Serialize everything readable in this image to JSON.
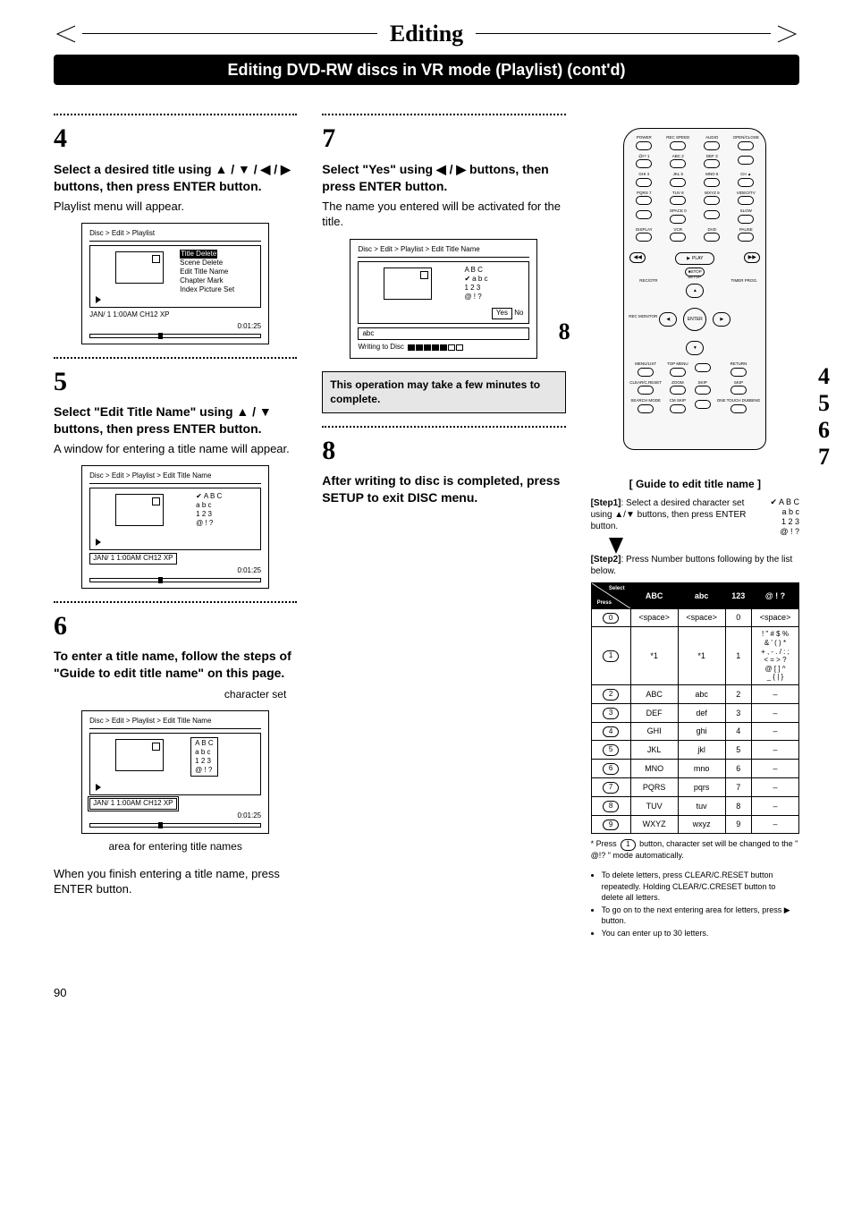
{
  "header": {
    "title": "Editing",
    "subtitle": "Editing DVD-RW discs in VR mode (Playlist) (cont'd)"
  },
  "steps": {
    "s4": {
      "num": "4",
      "bold": "Select a desired title using ▲ / ▼ / ◀ / ▶ buttons, then press ENTER button.",
      "text": "Playlist menu will appear.",
      "screen": {
        "crumb": "Disc > Edit > Playlist",
        "menu": [
          "Title Delete",
          "Scene Delete",
          "Edit Title Name",
          "Chapter Mark",
          "Index Picture Set"
        ],
        "status": "JAN/ 1   1:00AM   CH12      XP",
        "timer": "0:01:25"
      }
    },
    "s5": {
      "num": "5",
      "bold": "Select \"Edit Title Name\" using ▲ / ▼ buttons, then press ENTER button.",
      "text": "A window for entering a title name will appear.",
      "screen": {
        "crumb": "Disc > Edit > Playlist > Edit Title Name",
        "charset": [
          "A B C",
          "a b c",
          "1 2 3",
          "@ ! ?"
        ],
        "statusbox": "JAN/ 1   1:00AM   CH12   XP",
        "timer": "0:01:25"
      }
    },
    "s6": {
      "num": "6",
      "bold": "To enter a title name, follow the steps of \"Guide to edit title name\" on this page.",
      "label_charset": "character set",
      "screen": {
        "crumb": "Disc > Edit  > Playlist > Edit Title Name",
        "charset": [
          "A B C",
          "a b c",
          "1 2 3",
          "@ ! ?"
        ],
        "statusbox": "JAN/ 1   1:00AM   CH12   XP",
        "timer": "0:01:25"
      },
      "label_area": "area for entering title names",
      "text2": "When you finish entering a title name, press ENTER button."
    },
    "s7": {
      "num": "7",
      "bold": "Select \"Yes\" using ◀ / ▶ buttons, then press ENTER button.",
      "text": "The name you entered will be activated for the title.",
      "screen": {
        "crumb": "Disc > Edit > Playlist > Edit Title Name",
        "charset": [
          "A B C",
          "a b c",
          "1 2 3",
          "@ ! ?"
        ],
        "yes": "Yes",
        "no": "No",
        "input": "abc",
        "writing": "Writing to Disc"
      },
      "note": "This operation may take a few minutes to complete."
    },
    "s8": {
      "num": "8",
      "bold": "After writing to disc is completed, press SETUP to exit DISC menu."
    }
  },
  "remote_callouts": {
    "left": "8",
    "r1": "4",
    "r2": "5",
    "r3": "6",
    "r4": "7"
  },
  "remote_rows": [
    [
      "POWER",
      "REC SPEED",
      "AUDIO",
      "OPEN/CLOSE"
    ],
    [
      "@!?  1",
      "ABC  2",
      "DEF  3",
      ""
    ],
    [
      "GHI  4",
      "JKL  5",
      "MNO  6",
      "CH ▲"
    ],
    [
      "PQRS 7",
      "TUV  8",
      "WXYZ 9",
      "VIDEO/TV"
    ],
    [
      "",
      "SPACE 0",
      "",
      "SLOW"
    ],
    [
      "DISPLAY",
      "VCR",
      "DVD",
      "PAUSE"
    ]
  ],
  "remote_mid": {
    "play": "PLAY",
    "stop": "STOP",
    "rev": "◀◀",
    "fwd": "▶▶"
  },
  "remote_cross": {
    "up": "SETUP",
    "down": "ENTER",
    "left": "REC MONITOR",
    "right": "TIMER PROG.",
    "top": "REC/OTR"
  },
  "remote_rows2": [
    [
      "MENU/LIST",
      "TOP MENU",
      "",
      "RETURN"
    ],
    [
      "CLEAR/C.RESET",
      "ZOOM",
      "SKIP",
      "SKIP"
    ],
    [
      "SEARCH MODE",
      "CM SKIP",
      "",
      "ONE TOUCH DUBBING"
    ]
  ],
  "guide": {
    "title": "[ Guide to edit title name ]",
    "step1_label": "[Step1]",
    "step1_text": ": Select a desired character set using ▲/▼ buttons, then press ENTER button.",
    "charset": [
      "A B C",
      "a b c",
      "1 2 3",
      "@ ! ?"
    ],
    "step2_label": "[Step2]",
    "step2_text": ": Press Number buttons following by the list below.",
    "headers": {
      "corner_top": "Select",
      "corner_bot": "Press",
      "c1": "ABC",
      "c2": "abc",
      "c3": "123",
      "c4": "@ ! ?"
    },
    "rows": [
      {
        "key": "0",
        "c1": "<space>",
        "c2": "<space>",
        "c3": "0",
        "c4": "<space>"
      },
      {
        "key": "1",
        "c1": "*1",
        "c2": "*1",
        "c3": "1",
        "c4": "! \" # $ %\n& ' ( ) *\n+ , - . / : ;\n< = > ?\n@ [ ] ^\n_ { | }"
      },
      {
        "key": "2",
        "c1": "ABC",
        "c2": "abc",
        "c3": "2",
        "c4": "–"
      },
      {
        "key": "3",
        "c1": "DEF",
        "c2": "def",
        "c3": "3",
        "c4": "–"
      },
      {
        "key": "4",
        "c1": "GHI",
        "c2": "ghi",
        "c3": "4",
        "c4": "–"
      },
      {
        "key": "5",
        "c1": "JKL",
        "c2": "jkl",
        "c3": "5",
        "c4": "–"
      },
      {
        "key": "6",
        "c1": "MNO",
        "c2": "mno",
        "c3": "6",
        "c4": "–"
      },
      {
        "key": "7",
        "c1": "PQRS",
        "c2": "pqrs",
        "c3": "7",
        "c4": "–"
      },
      {
        "key": "8",
        "c1": "TUV",
        "c2": "tuv",
        "c3": "8",
        "c4": "–"
      },
      {
        "key": "9",
        "c1": "WXYZ",
        "c2": "wxyz",
        "c3": "9",
        "c4": "–"
      }
    ],
    "footnote_pre": "* Press ",
    "footnote_key": "1",
    "footnote_post": " button, character set will be changed to the \" @!? \" mode automatically.",
    "bullets": [
      "To delete letters, press CLEAR/C.RESET button repeatedly. Holding CLEAR/C.CRESET button to delete all letters.",
      "To go on to the next entering area for letters, press ▶ button.",
      "You can enter up to 30 letters."
    ]
  },
  "page_number": "90"
}
